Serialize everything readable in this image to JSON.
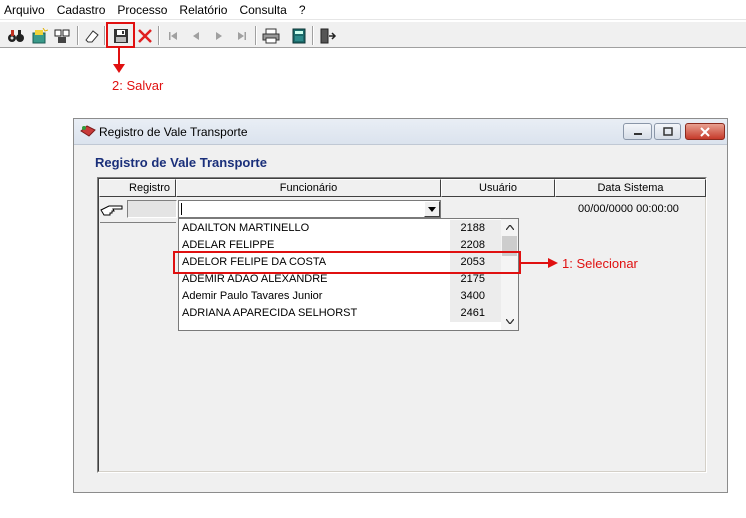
{
  "menu": [
    "Arquivo",
    "Cadastro",
    "Processo",
    "Relatório",
    "Consulta",
    "?"
  ],
  "toolbar": {
    "icons": [
      "binoculars-icon",
      "new-record-icon",
      "search-records-icon",
      "eraser-icon",
      "save-icon",
      "cancel-icon",
      "first-icon",
      "prev-icon",
      "next-icon",
      "last-icon",
      "print-icon",
      "calculator-icon",
      "exit-icon"
    ]
  },
  "annotations": {
    "save": "2: Salvar",
    "select": "1: Selecionar",
    "color": "#e01010"
  },
  "window": {
    "title": "Registro de Vale Transporte",
    "heading": "Registro de Vale Transporte",
    "columns": {
      "registro": "Registro",
      "funcionario": "Funcionário",
      "usuario": "Usuário",
      "data": "Data Sistema"
    },
    "row": {
      "registro": "",
      "funcionario": "",
      "data_sistema": "00/00/0000 00:00:00"
    },
    "dropdown": [
      {
        "name": "ADAILTON MARTINELLO",
        "code": "2188"
      },
      {
        "name": "ADELAR FELIPPE",
        "code": "2208"
      },
      {
        "name": "ADELOR FELIPE DA COSTA",
        "code": "2053"
      },
      {
        "name": "ADEMIR ADÃO ALEXANDRE",
        "code": "2175"
      },
      {
        "name": "Ademir Paulo Tavares Junior",
        "code": "3400"
      },
      {
        "name": "ADRIANA APARECIDA SELHORST",
        "code": "2461"
      }
    ]
  }
}
